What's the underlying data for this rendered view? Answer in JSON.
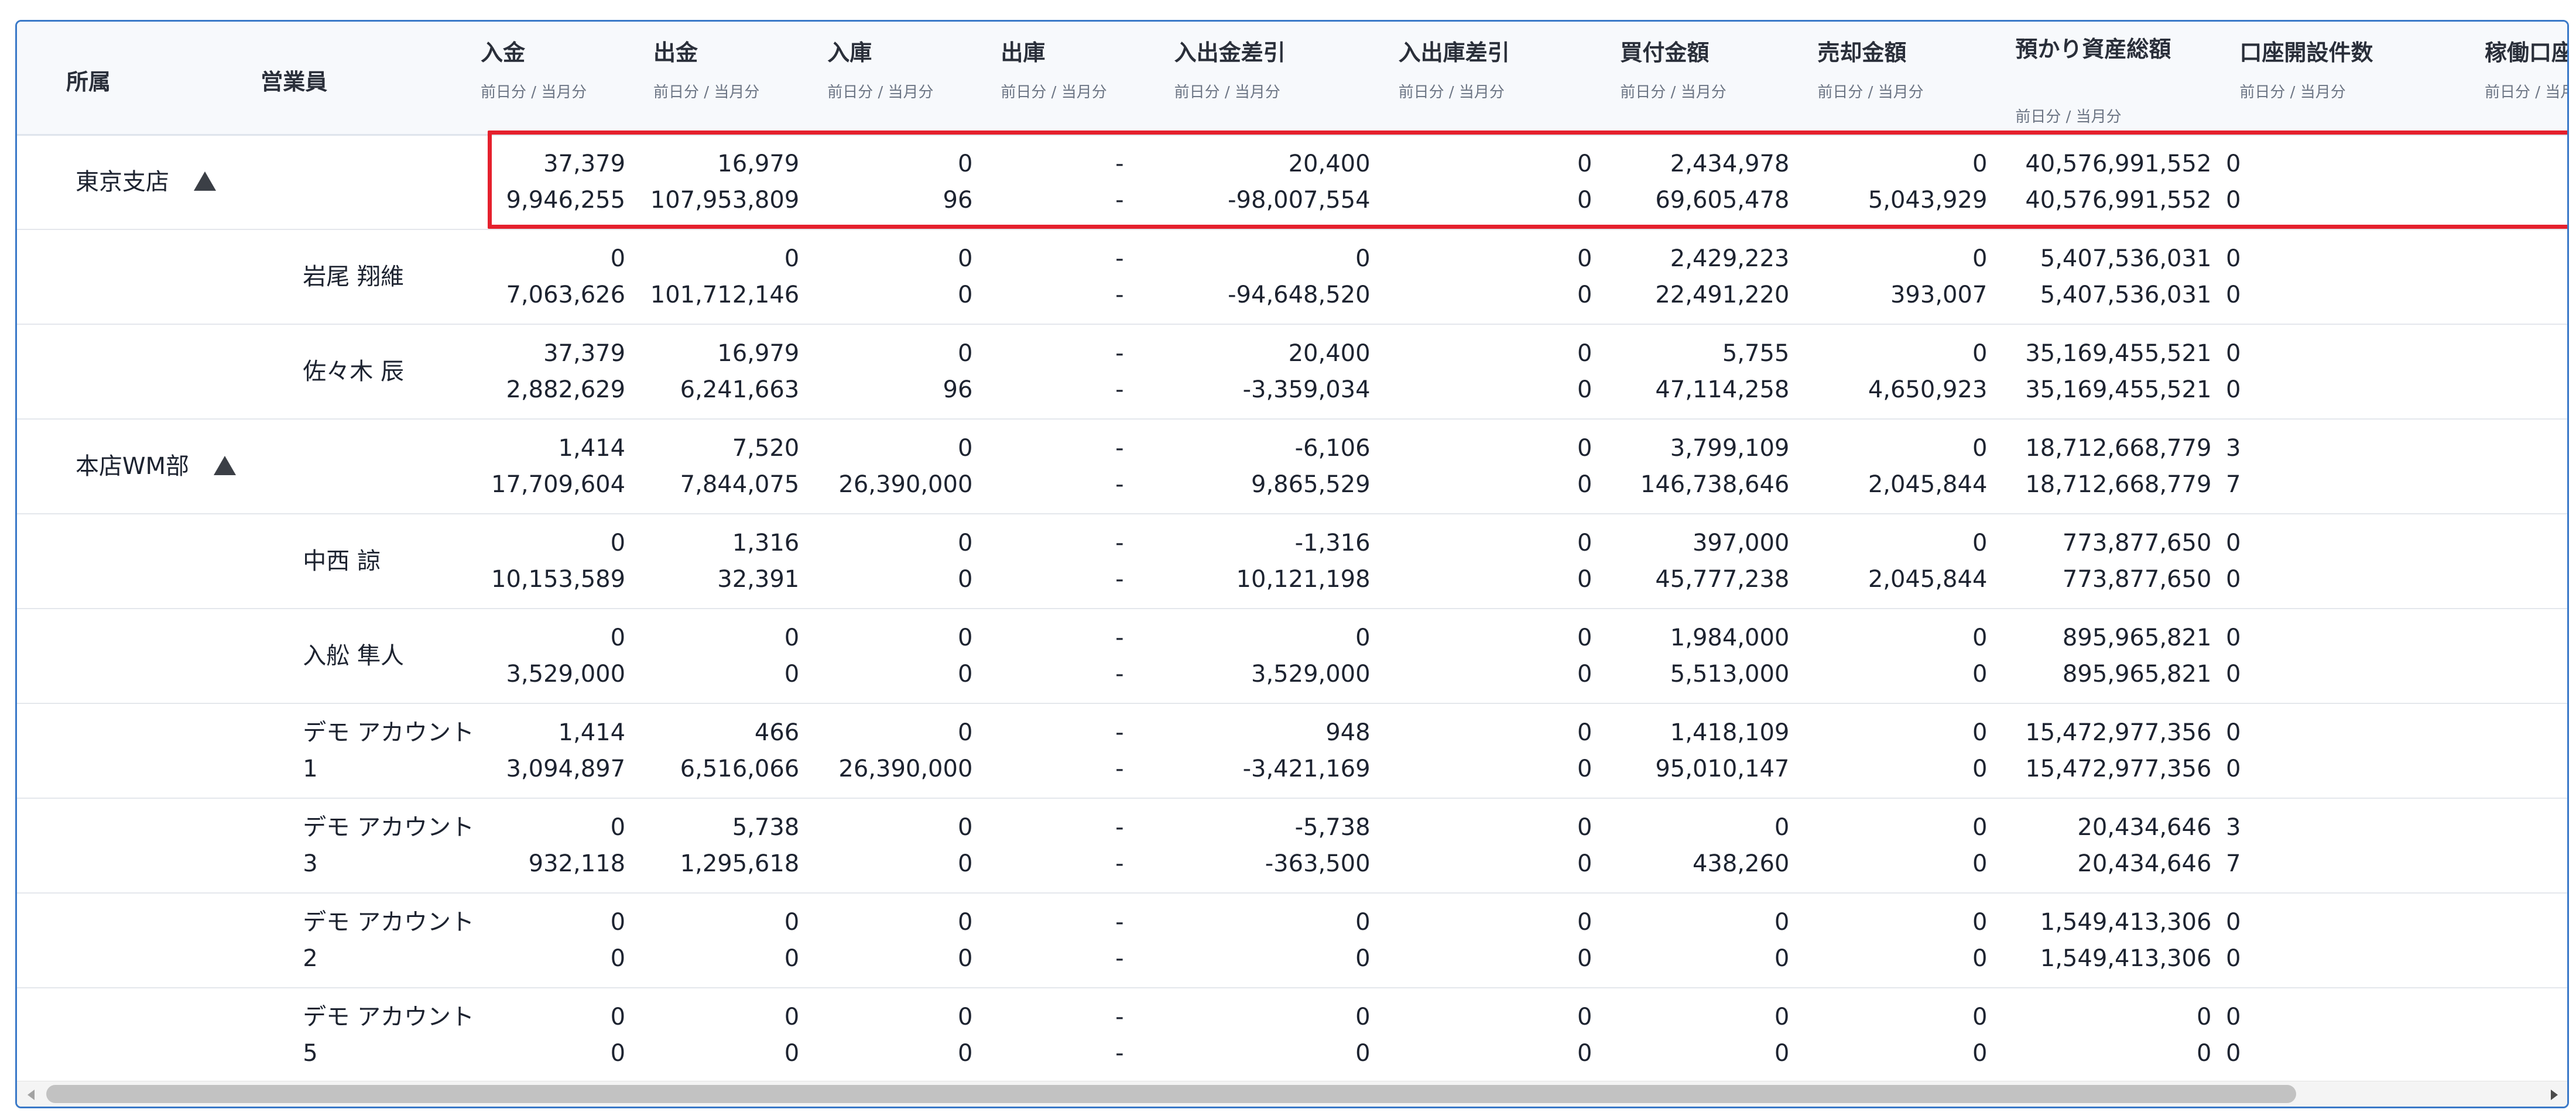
{
  "headers": {
    "affiliation": "所属",
    "sales_rep": "営業員",
    "deposit": "入金",
    "withdrawal": "出金",
    "stock_in": "入庫",
    "stock_out": "出庫",
    "cash_diff": "入出金差引",
    "stock_diff": "入出庫差引",
    "buy_amount": "買付金額",
    "sell_amount": "売却金額",
    "total_assets": "預かり資産総額",
    "accounts_opened": "口座開設件数",
    "active_accounts": "稼働口座数",
    "period_sub": "前日分 / 当月分"
  },
  "rows": [
    {
      "affiliation": "東京支店",
      "rep": "",
      "prev": [
        "37,379",
        "16,979",
        "0",
        "-",
        "20,400",
        "0",
        "2,434,978",
        "0",
        "40,576,991,552",
        "0"
      ],
      "month": [
        "9,946,255",
        "107,953,809",
        "96",
        "-",
        "-98,007,554",
        "0",
        "69,605,478",
        "5,043,929",
        "40,576,991,552",
        "0"
      ]
    },
    {
      "affiliation": "",
      "rep": "岩尾 翔維",
      "prev": [
        "0",
        "0",
        "0",
        "-",
        "0",
        "0",
        "2,429,223",
        "0",
        "5,407,536,031",
        "0"
      ],
      "month": [
        "7,063,626",
        "101,712,146",
        "0",
        "-",
        "-94,648,520",
        "0",
        "22,491,220",
        "393,007",
        "5,407,536,031",
        "0"
      ]
    },
    {
      "affiliation": "",
      "rep": "佐々木 辰",
      "prev": [
        "37,379",
        "16,979",
        "0",
        "-",
        "20,400",
        "0",
        "5,755",
        "0",
        "35,169,455,521",
        "0"
      ],
      "month": [
        "2,882,629",
        "6,241,663",
        "96",
        "-",
        "-3,359,034",
        "0",
        "47,114,258",
        "4,650,923",
        "35,169,455,521",
        "0"
      ]
    },
    {
      "affiliation": "本店WM部",
      "rep": "",
      "prev": [
        "1,414",
        "7,520",
        "0",
        "-",
        "-6,106",
        "0",
        "3,799,109",
        "0",
        "18,712,668,779",
        "3"
      ],
      "month": [
        "17,709,604",
        "7,844,075",
        "26,390,000",
        "-",
        "9,865,529",
        "0",
        "146,738,646",
        "2,045,844",
        "18,712,668,779",
        "7"
      ]
    },
    {
      "affiliation": "",
      "rep": "中西 諒",
      "prev": [
        "0",
        "1,316",
        "0",
        "-",
        "-1,316",
        "0",
        "397,000",
        "0",
        "773,877,650",
        "0"
      ],
      "month": [
        "10,153,589",
        "32,391",
        "0",
        "-",
        "10,121,198",
        "0",
        "45,777,238",
        "2,045,844",
        "773,877,650",
        "0"
      ]
    },
    {
      "affiliation": "",
      "rep": "入舩 隼人",
      "prev": [
        "0",
        "0",
        "0",
        "-",
        "0",
        "0",
        "1,984,000",
        "0",
        "895,965,821",
        "0"
      ],
      "month": [
        "3,529,000",
        "0",
        "0",
        "-",
        "3,529,000",
        "0",
        "5,513,000",
        "0",
        "895,965,821",
        "0"
      ]
    },
    {
      "affiliation": "",
      "rep": "デモ アカウント 1",
      "prev": [
        "1,414",
        "466",
        "0",
        "-",
        "948",
        "0",
        "1,418,109",
        "0",
        "15,472,977,356",
        "0"
      ],
      "month": [
        "3,094,897",
        "6,516,066",
        "26,390,000",
        "-",
        "-3,421,169",
        "0",
        "95,010,147",
        "0",
        "15,472,977,356",
        "0"
      ]
    },
    {
      "affiliation": "",
      "rep": "デモ アカウント 3",
      "prev": [
        "0",
        "5,738",
        "0",
        "-",
        "-5,738",
        "0",
        "0",
        "0",
        "20,434,646",
        "3"
      ],
      "month": [
        "932,118",
        "1,295,618",
        "0",
        "-",
        "-363,500",
        "0",
        "438,260",
        "0",
        "20,434,646",
        "7"
      ]
    },
    {
      "affiliation": "",
      "rep": "デモ アカウント 2",
      "prev": [
        "0",
        "0",
        "0",
        "-",
        "0",
        "0",
        "0",
        "0",
        "1,549,413,306",
        "0"
      ],
      "month": [
        "0",
        "0",
        "0",
        "-",
        "0",
        "0",
        "0",
        "0",
        "1,549,413,306",
        "0"
      ]
    },
    {
      "affiliation": "",
      "rep": "デモ アカウント 5",
      "prev": [
        "0",
        "0",
        "0",
        "-",
        "0",
        "0",
        "0",
        "0",
        "0",
        "0"
      ],
      "month": [
        "0",
        "0",
        "0",
        "-",
        "0",
        "0",
        "0",
        "0",
        "0",
        "0"
      ]
    }
  ]
}
